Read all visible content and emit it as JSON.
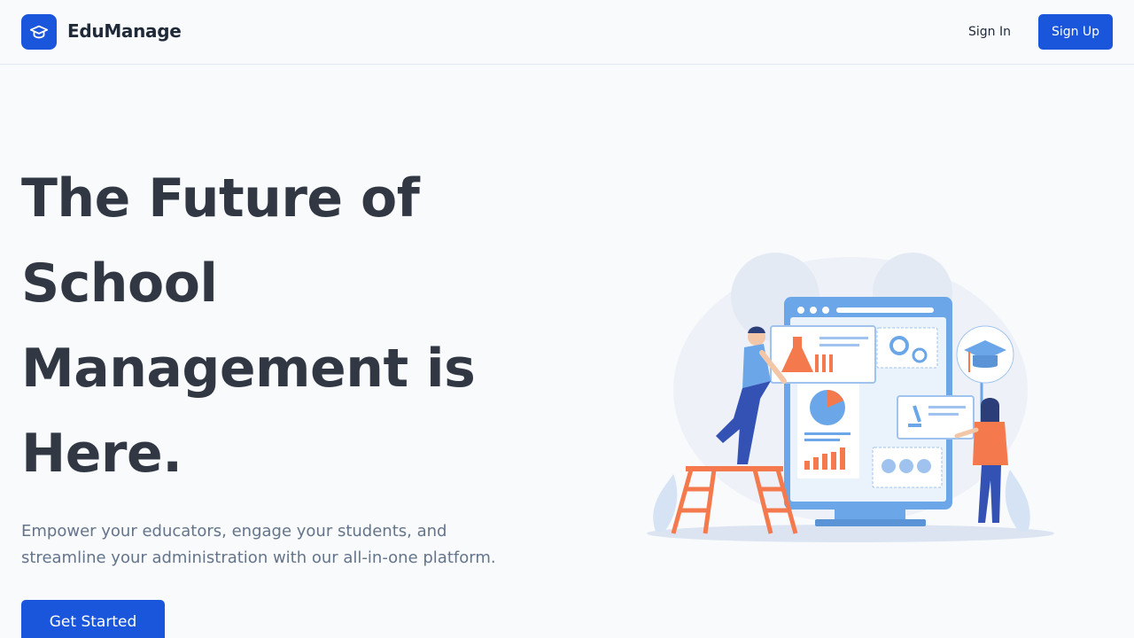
{
  "header": {
    "brand": "EduManage",
    "logo_icon": "graduation-cap-icon",
    "sign_in_label": "Sign In",
    "sign_up_label": "Sign Up"
  },
  "hero": {
    "title_lines": [
      "The Future of",
      "School",
      "Management is",
      "Here."
    ],
    "subtitle": "Empower your educators, engage your students, and streamline your administration with our all-in-one platform.",
    "cta_label": "Get Started"
  },
  "colors": {
    "primary": "#1a56db",
    "title": "#323843",
    "muted": "#64748b",
    "background": "#f8fafc",
    "accent_orange": "#f47a4e",
    "accent_blue": "#6ba7e8"
  }
}
